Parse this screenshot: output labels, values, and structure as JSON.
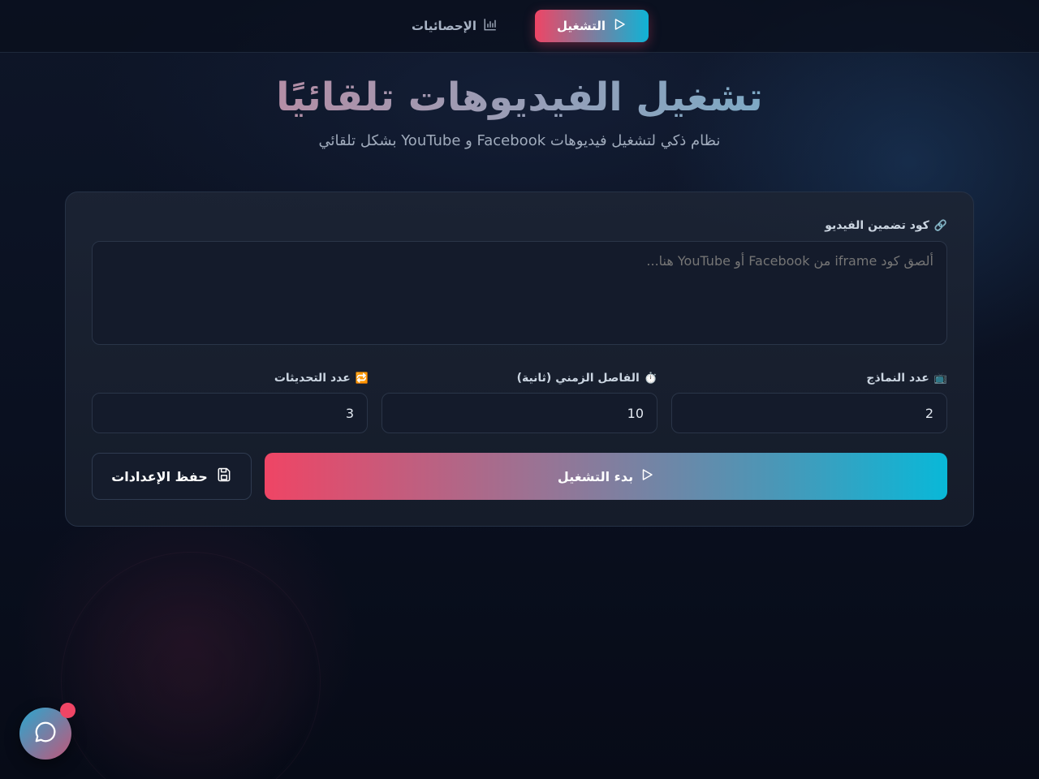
{
  "nav": {
    "run_label": "التشغيل",
    "stats_label": "الإحصائيات",
    "run_icon": "play-icon",
    "stats_icon": "bar-chart-icon"
  },
  "hero": {
    "title": "تشغيل الفيديوهات تلقائيًا",
    "subtitle": "نظام ذكي لتشغيل فيديوهات Facebook و YouTube بشكل تلقائي"
  },
  "form": {
    "embed_label": "كود تضمين الفيديو",
    "embed_icon": "🔗",
    "embed_placeholder": "ألصق كود iframe من Facebook أو YouTube هنا...",
    "models_label": "عدد النماذج",
    "models_icon": "📺",
    "models_value": "2",
    "interval_label": "الفاصل الزمني (ثانية)",
    "interval_icon": "⏱️",
    "interval_value": "10",
    "refresh_label": "عدد التحديثات",
    "refresh_icon": "🔁",
    "refresh_value": "3",
    "start_label": "بدء التشغيل",
    "save_label": "حفظ الإعدادات"
  },
  "colors": {
    "accent_pink": "#ef4565",
    "accent_cyan": "#0fb3d6",
    "background": "#0b1120"
  }
}
